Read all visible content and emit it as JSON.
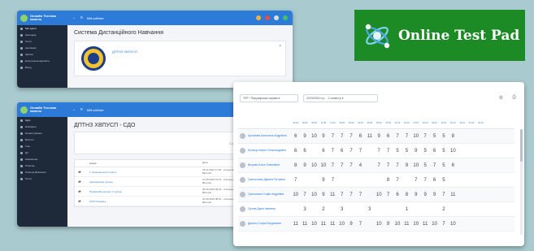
{
  "colors": {
    "primary": "#2d7bd8",
    "sidebar": "#1e2a3a",
    "logo_bg": "#1c8a25",
    "backdrop": "#a9cbcf"
  },
  "logo": {
    "text": "Online Test Pad",
    "icon": "molecule-logo-icon"
  },
  "panel1": {
    "brand": "Онлайн Тестова панель",
    "topbar_label": "Мій кабінет",
    "sidebar_items": [
      "Мої курси",
      "Календар",
      "Тести",
      "Кропівник",
      "Записи",
      "Електронна відомість",
      "Вихід"
    ],
    "page_title": "Система Дистанційного Навчання",
    "card_link": "ДПТНЗ ХВПУСП"
  },
  "panel2": {
    "brand": "Онлайн Тестова панель",
    "topbar_label": "Мій кабінет",
    "page_title": "ДПТНЗ ХВПУСП - СДО",
    "bar_text": "Сортування",
    "sidebar_items": [
      "Курс",
      "Навчання",
      "Налаштування",
      "Вчителі",
      "Учні",
      "Дії",
      "Навчальне",
      "Розклад",
      "Розклад Вивчення",
      "Тести"
    ],
    "table_head": [
      "Назва",
      "Дата"
    ],
    "rows": [
      {
        "name": "Г. Національна історія ▸",
        "date": "18.11.2023 17:00 · Створено Мельник Вікторія"
      },
      {
        "name": "Інформатика група ▸",
        "date": "12.09.2023 10:15 · Створено Мельник Вікторія"
      },
      {
        "name": "Професійні методи 1 група ▸",
        "date": "05.09.2023 09:40 · Створено Мельник Вікторія"
      },
      {
        "name": "ООП Основи ▸",
        "date": "01.09.2023 08:00 · Створено Мельник Вікторія"
      }
    ]
  },
  "grades": {
    "group_select": "ТЕР / Перукарська справа",
    "period_select": "2023/2024 н.р. - 1 семестр",
    "headers": [
      "04.09",
      "05.09",
      "06.09",
      "11.09",
      "11.09",
      "18.09",
      "18.09",
      "19.09",
      "25.09",
      "25.09",
      "26.09",
      "02.10",
      "02.10",
      "03.10",
      "09.10",
      "09.10",
      "16.10",
      "16.10",
      "23.10",
      "23.10",
      "24.10"
    ],
    "students": [
      {
        "name": "Архипова Анастасія Андріївна",
        "grades": [
          "6",
          "9",
          "10",
          "9",
          "7",
          "7",
          "7",
          "6",
          "11",
          "9",
          "6",
          "7",
          "7",
          "10",
          "7",
          "5",
          "5",
          "8",
          "",
          "",
          ""
        ]
      },
      {
        "name": "Бугаєць Марія Олександрівна",
        "grades": [
          "6",
          "6",
          "",
          "6",
          "7",
          "6",
          "7",
          "7",
          "",
          "7",
          "7",
          "5",
          "5",
          "9",
          "5",
          "6",
          "5",
          "10",
          "",
          "",
          ""
        ]
      },
      {
        "name": "Віхрова Алла Олексіївна",
        "grades": [
          "8",
          "9",
          "10",
          "10",
          "7",
          "7",
          "7",
          "4",
          "",
          "7",
          "7",
          "7",
          "9",
          "10",
          "5",
          "7",
          "5",
          "6",
          "",
          "",
          ""
        ]
      },
      {
        "name": "Гринчичина Дарина Петрівна",
        "grades": [
          "7",
          "",
          "",
          "9",
          "7",
          "",
          "",
          "",
          "",
          "",
          "8",
          "7",
          "",
          "7",
          "7",
          "6",
          "5",
          "",
          "",
          "",
          ""
        ]
      },
      {
        "name": "Гринчишин Софія Андріївна",
        "grades": [
          "10",
          "7",
          "10",
          "9",
          "11",
          "7",
          "7",
          "7",
          "",
          "10",
          "7",
          "6",
          "8",
          "9",
          "9",
          "9",
          "7",
          "11",
          "",
          "",
          ""
        ]
      },
      {
        "name": "Гусєва Дарія Іванівна",
        "grades": [
          "",
          "3",
          "",
          "2",
          "",
          "3",
          "",
          "",
          "3",
          "",
          "",
          "",
          "1",
          "",
          "",
          "",
          "2",
          "",
          "",
          "",
          ""
        ]
      },
      {
        "name": "Данило Софія Богданівна",
        "grades": [
          "11",
          "11",
          "10",
          "11",
          "11",
          "10",
          "9",
          "7",
          "",
          "10",
          "9",
          "10",
          "11",
          "10",
          "11",
          "10",
          "7",
          "10",
          "",
          "",
          ""
        ]
      }
    ]
  }
}
